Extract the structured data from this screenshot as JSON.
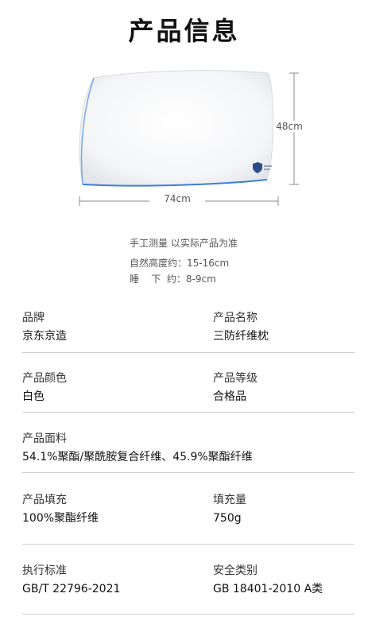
{
  "header": {
    "title": "产品信息"
  },
  "diagram": {
    "width_label": "74cm",
    "height_label": "48cm"
  },
  "notes": {
    "line1": "手工测量 以实际产品为准",
    "line2": "自然高度约：15-16cm",
    "line3": "睡    下  约：8-9cm"
  },
  "specs": {
    "brand": {
      "label": "品牌",
      "value": "京东京造"
    },
    "name": {
      "label": "产品名称",
      "value": "三防纤维枕"
    },
    "color": {
      "label": "产品颜色",
      "value": "白色"
    },
    "grade": {
      "label": "产品等级",
      "value": "合格品"
    },
    "fabric": {
      "label": "产品面料",
      "value": "54.1%聚酯/聚酰胺复合纤维、45.9%聚酯纤维"
    },
    "filling": {
      "label": "产品填充",
      "value": "100%聚酯纤维"
    },
    "fill_weight": {
      "label": "填充量",
      "value": "750g"
    },
    "standard": {
      "label": "执行标准",
      "value": "GB/T 22796-2021"
    },
    "safety": {
      "label": "安全类别",
      "value": "GB 18401-2010 A类"
    }
  },
  "colors": {
    "piping": "#3d7fd6",
    "divider": "#cfcfcf"
  }
}
